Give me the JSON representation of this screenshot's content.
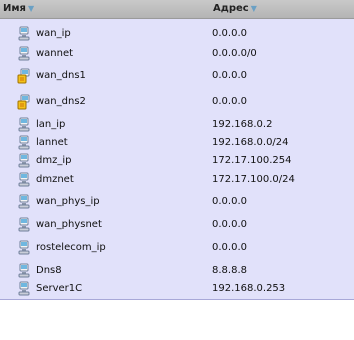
{
  "columns": {
    "name": "Имя",
    "address": "Адрес"
  },
  "rows": [
    {
      "name": "wan_ip",
      "address": "0.0.0.0",
      "icon": "host-icon"
    },
    {
      "name": "wannet",
      "address": "0.0.0.0/0",
      "icon": "host-icon"
    },
    {
      "name": "wan_dns1",
      "address": "0.0.0.0",
      "icon": "dns-warning-icon"
    },
    {
      "name": "wan_dns2",
      "address": "0.0.0.0",
      "icon": "dns-warning-icon"
    },
    {
      "name": "lan_ip",
      "address": "192.168.0.2",
      "icon": "host-icon"
    },
    {
      "name": "lannet",
      "address": "192.168.0.0/24",
      "icon": "host-icon"
    },
    {
      "name": "dmz_ip",
      "address": "172.17.100.254",
      "icon": "host-icon"
    },
    {
      "name": "dmznet",
      "address": "172.17.100.0/24",
      "icon": "host-icon"
    },
    {
      "name": "wan_phys_ip",
      "address": "0.0.0.0",
      "icon": "host-icon"
    },
    {
      "name": "wan_physnet",
      "address": "0.0.0.0",
      "icon": "host-icon"
    },
    {
      "name": "rostelecom_ip",
      "address": "0.0.0.0",
      "icon": "host-icon"
    },
    {
      "name": "Dns8",
      "address": "8.8.8.8",
      "icon": "host-icon"
    },
    {
      "name": "Server1C",
      "address": "192.168.0.253",
      "icon": "host-icon"
    }
  ]
}
